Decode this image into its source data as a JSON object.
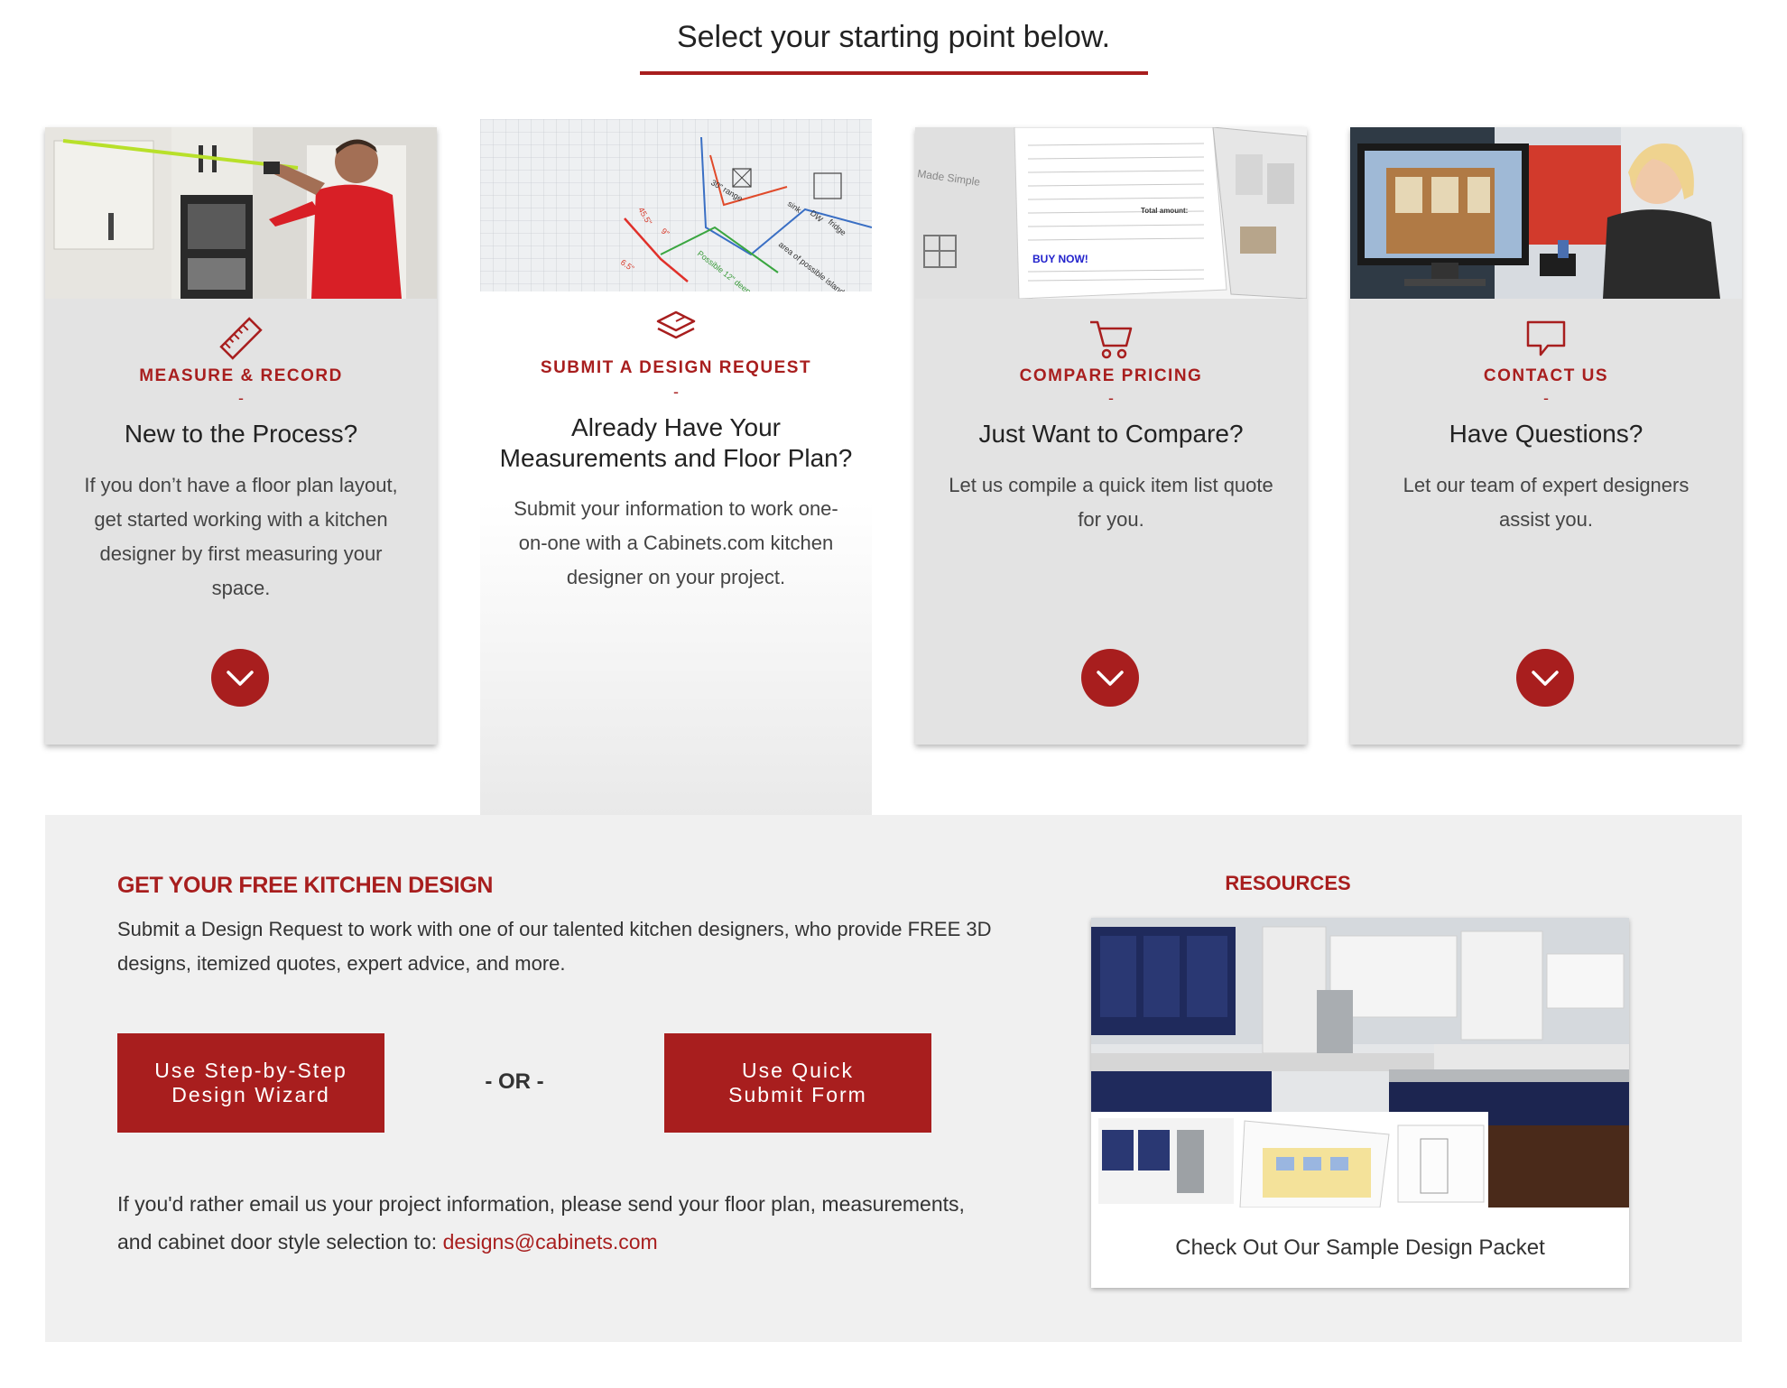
{
  "page": {
    "heading": "Select your starting point below."
  },
  "cards": [
    {
      "category": "MEASURE & RECORD",
      "dash": "-",
      "title": "New to the Process?",
      "description": "If you don’t have a floor plan layout, get started working with a kitchen designer by first measuring your space.",
      "icon": "ruler-icon"
    },
    {
      "category": "SUBMIT A DESIGN REQUEST",
      "dash": "-",
      "title": "Already Have Your Measurements and Floor Plan?",
      "description": "Submit your information to work one-on-one with a Cabinets.com kitchen designer on your project.",
      "icon": "floor-plan-icon"
    },
    {
      "category": "COMPARE PRICING",
      "dash": "-",
      "title": "Just Want to Compare?",
      "description": "Let us compile a quick item list quote for you.",
      "icon": "cart-icon"
    },
    {
      "category": "CONTACT US",
      "dash": "-",
      "title": "Have Questions?",
      "description": "Let our team of expert designers assist you.",
      "icon": "speech-bubble-icon"
    }
  ],
  "images": {
    "floor_plan_labels": [
      "30\" range",
      "sink",
      "DW",
      "fridge",
      "area of possible island",
      "Possible 12\" deep",
      "45.5\"",
      "9\"",
      "6.5\""
    ],
    "quote_labels": {
      "made_simple": "Made Simple",
      "buy_now": "BUY NOW!",
      "total": "Total amount:"
    }
  },
  "design": {
    "title": "GET YOUR FREE KITCHEN DESIGN",
    "description": "Submit a Design Request to work with one of our talented kitchen designers, who provide FREE 3D designs, itemized quotes, expert advice, and more.",
    "wizard_button": "Use Step-by-Step Design Wizard",
    "or_text": "- OR -",
    "quick_button": "Use Quick Submit Form",
    "email_text": "If you'd rather email us your project information, please send your floor plan, measurements, and cabinet door style selection to: ",
    "email_link": "designs@cabinets.com"
  },
  "resources": {
    "title": "RESOURCES",
    "caption": "Check Out Our Sample Design Packet"
  },
  "colors": {
    "accent": "#a81e1e",
    "card_bg": "#e3e3e3",
    "section_bg": "#f0f0f0"
  }
}
